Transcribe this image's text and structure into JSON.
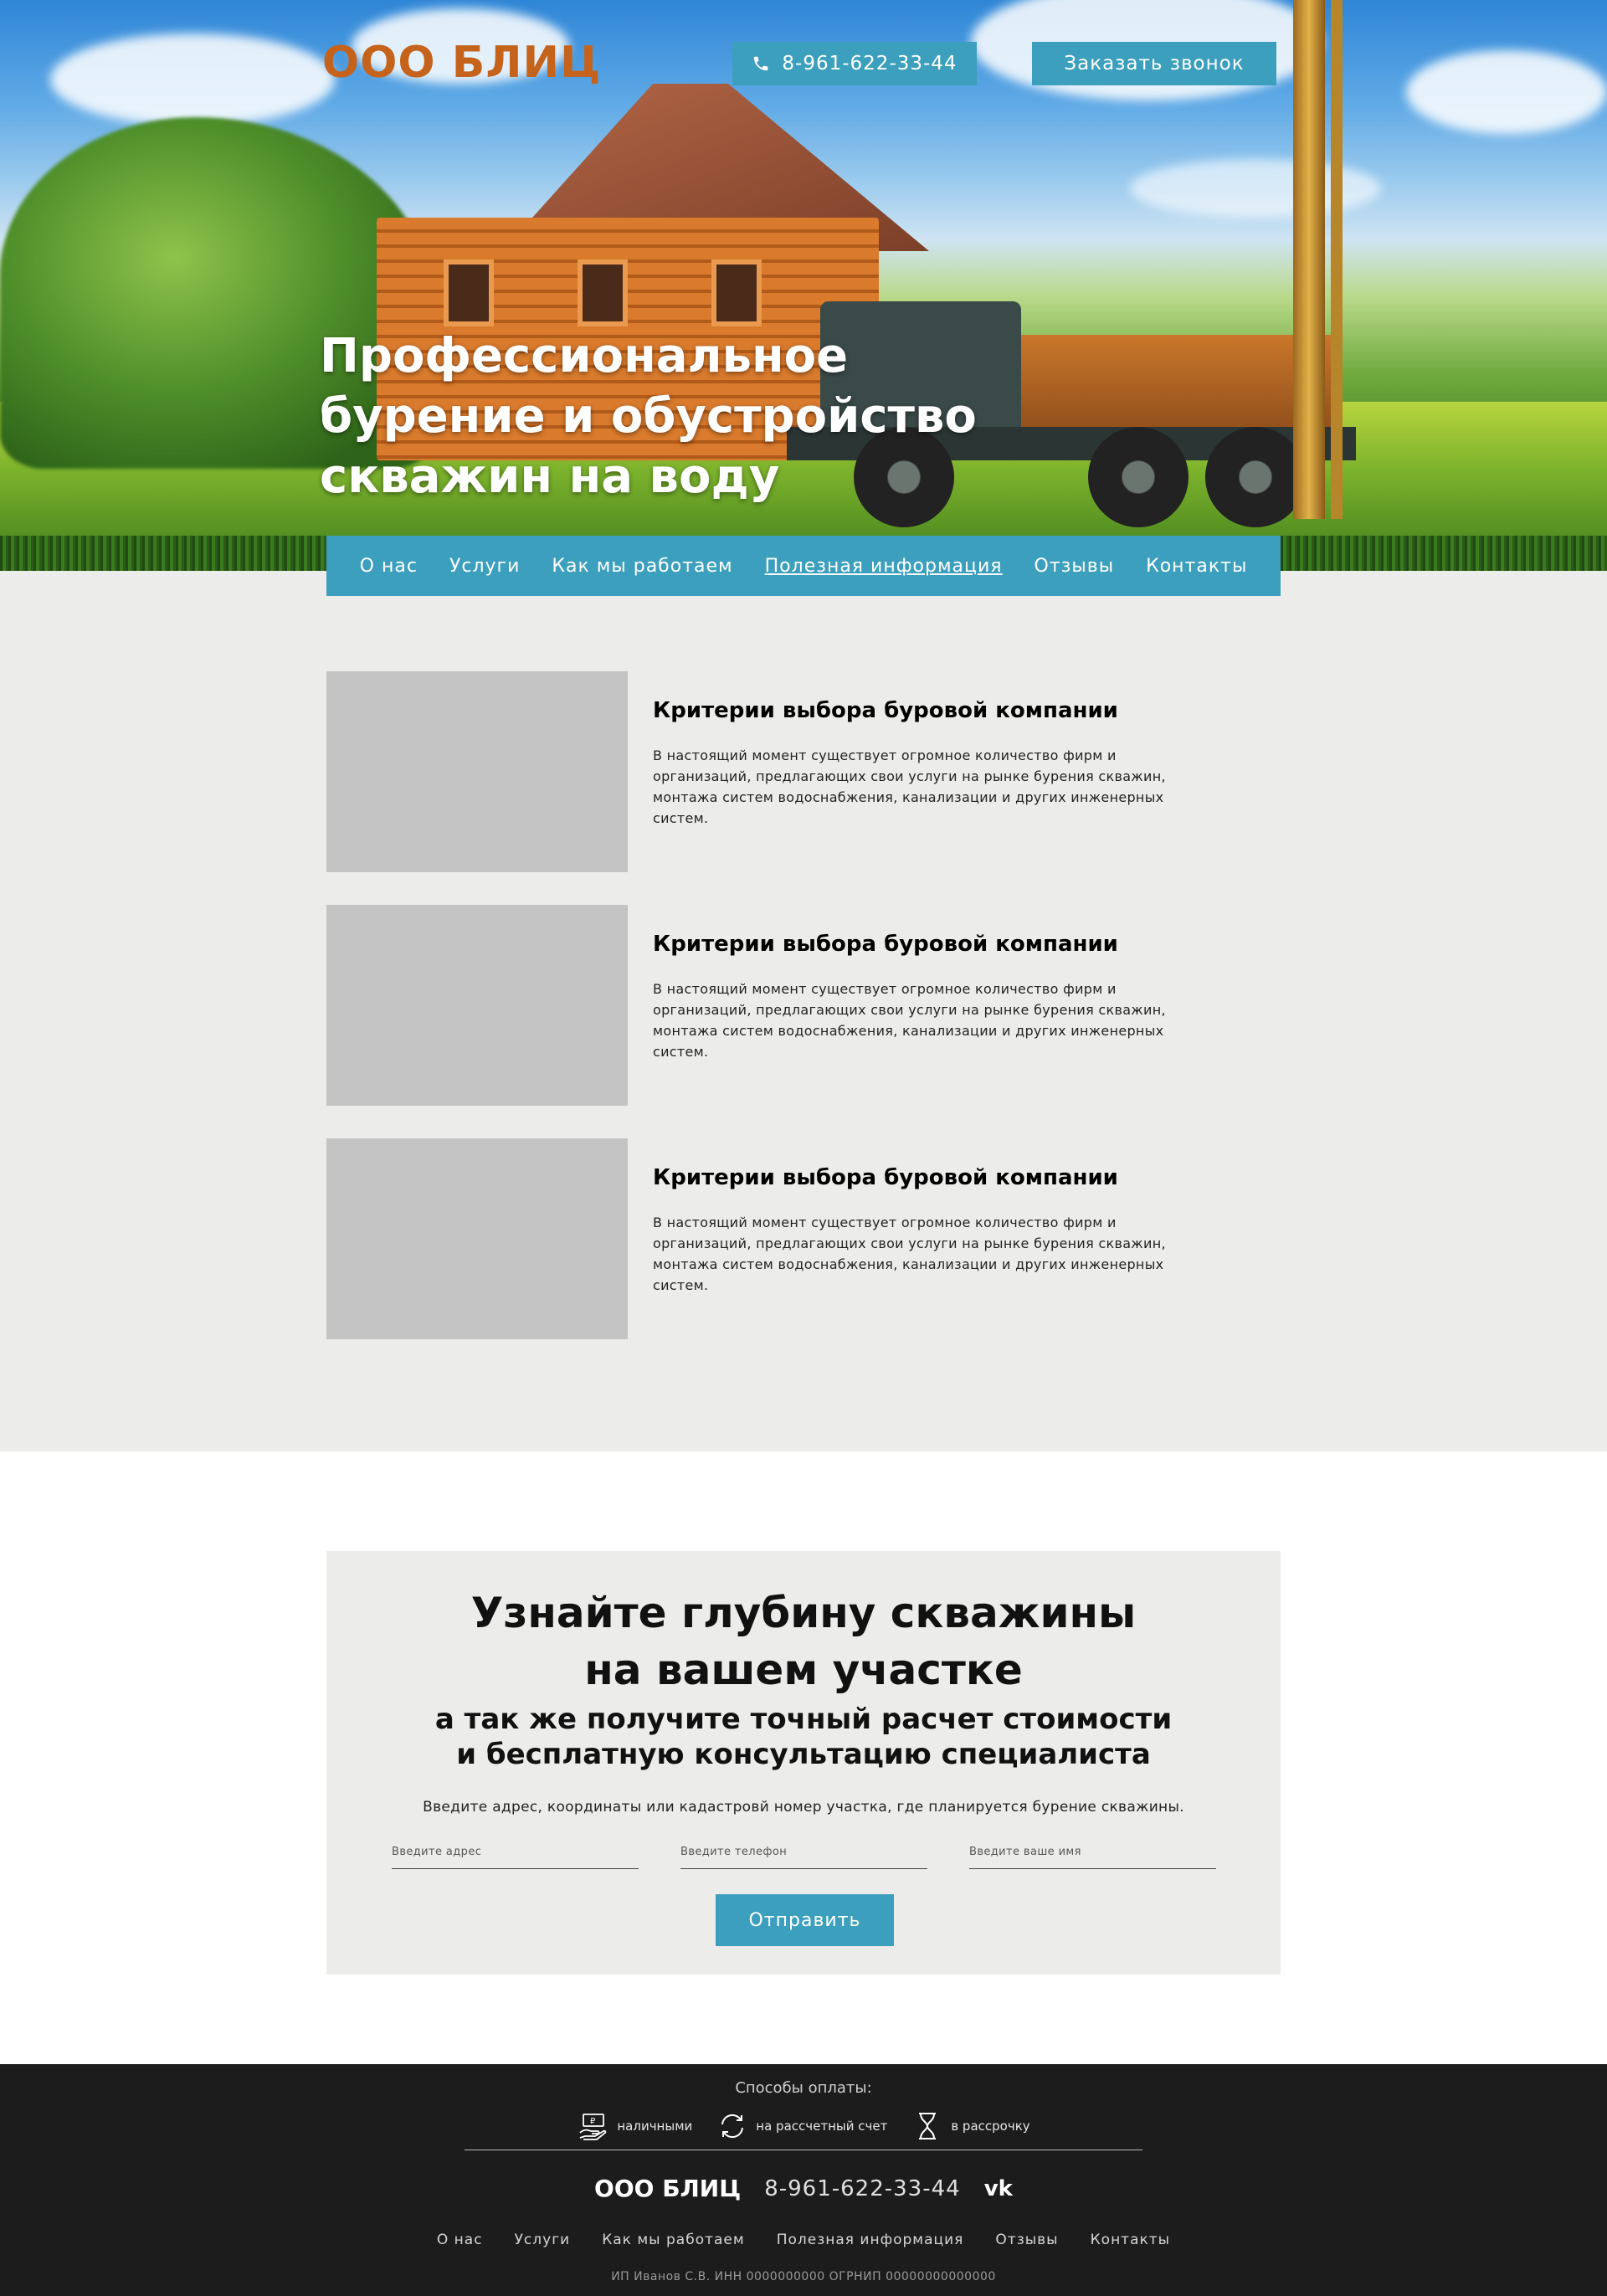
{
  "header": {
    "logo": "ООО БЛИЦ",
    "phone": "8-961-622-33-44",
    "callback_label": "Заказать звонок"
  },
  "hero": {
    "title_lines": [
      "Профессиональное",
      "бурение и обустройство",
      "скважин на воду"
    ]
  },
  "nav": {
    "items": [
      {
        "label": "О нас"
      },
      {
        "label": "Услуги"
      },
      {
        "label": "Как мы работаем"
      },
      {
        "label": "Полезная информация"
      },
      {
        "label": "Отзывы"
      },
      {
        "label": "Контакты"
      }
    ],
    "active": "Полезная информация"
  },
  "articles": [
    {
      "title": "Критерии выбора буровой компании",
      "text": "В настоящий момент существует огромное количество фирм и организаций, предлагающих свои услуги на рынке бурения скважин, монтажа систем водоснабжения, канализации и других инженерных систем."
    },
    {
      "title": "Критерии выбора буровой компании",
      "text": "В настоящий момент существует огромное количество фирм и организаций, предлагающих свои услуги на рынке бурения скважин, монтажа систем водоснабжения, канализации и других инженерных систем."
    },
    {
      "title": "Критерии выбора буровой компании",
      "text": "В настоящий момент существует огромное количество фирм и организаций, предлагающих свои услуги на рынке бурения скважин, монтажа систем водоснабжения, канализации и других инженерных систем."
    }
  ],
  "form": {
    "heading_lines": [
      "Узнайте глубину скважины",
      "на вашем участке"
    ],
    "sub_lines": [
      "а так же получите точный расчет стоимости",
      "и бесплатную консультацию специалиста"
    ],
    "hint": "Введите адрес, координаты или кадастровй номер участка, где планируется бурение скважины.",
    "address_placeholder": "Введите адрес",
    "phone_placeholder": "Введите телефон",
    "name_placeholder": "Введите ваше имя",
    "submit_label": "Отправить"
  },
  "footer": {
    "payment_title": "Способы оплаты:",
    "payments": [
      {
        "label": "наличными",
        "icon": "cash-hand-icon"
      },
      {
        "label": "на рассчетный счет",
        "icon": "transfer-arrows-icon"
      },
      {
        "label": "в рассрочку",
        "icon": "hourglass-icon"
      }
    ],
    "logo": "ООО БЛИЦ",
    "phone": "8-961-622-33-44",
    "vk": "vk",
    "nav": [
      "О нас",
      "Услуги",
      "Как мы работаем",
      "Полезная информация",
      "Отзывы",
      "Контакты"
    ],
    "legal": "ИП Иванов С.В. ИНН 0000000000 ОГРНИП 00000000000000"
  },
  "colors": {
    "accent": "#3c9fbd",
    "logo": "#c5631c",
    "section_bg": "#ececea",
    "footer_bg": "#1c1c1c",
    "placeholder_image": "#c4c4c4"
  }
}
